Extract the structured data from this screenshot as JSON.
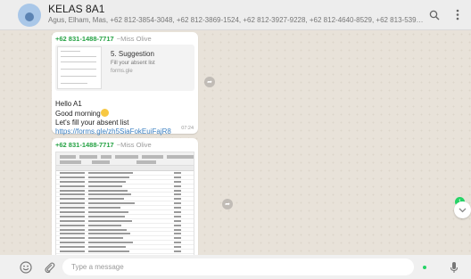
{
  "header": {
    "title": "KELAS 8A1",
    "participants": "Agus, Elham, Mas, +62 812-3854-3048, +62 812-3869-1524, +62 812-3927-9228, +62 812-4640-8529, +62 813-5391-2470, +62 813-...",
    "search_icon": "search-icon",
    "menu_icon": "menu-icon"
  },
  "messages": [
    {
      "sender": "+62 831-1488-7717",
      "push_name": "~Miss Olive",
      "link_preview": {
        "title": "5. Suggestion",
        "description": "Fill your absent list",
        "site": "forms.gle"
      },
      "lines": [
        "Hello A1",
        "Good morning",
        "Let's fill your absent list"
      ],
      "emoji": "😇",
      "link": "https://forms.gle/zh5SiaFokEuiFajR8",
      "time": "07:24"
    },
    {
      "sender": "+62 831-1488-7717",
      "push_name": "~Miss Olive",
      "attachment": "spreadsheet-image"
    }
  ],
  "unread_count": "1",
  "footer": {
    "placeholder": "Type a message",
    "emoji_icon": "emoji-icon",
    "attach_icon": "attach-icon",
    "mic_icon": "mic-icon"
  },
  "colors": {
    "sender": "#25a244",
    "link": "#3a7fc1",
    "unread_badge": "#25d366",
    "header_bg": "#ededed",
    "chat_bg": "#e8e2d9"
  }
}
